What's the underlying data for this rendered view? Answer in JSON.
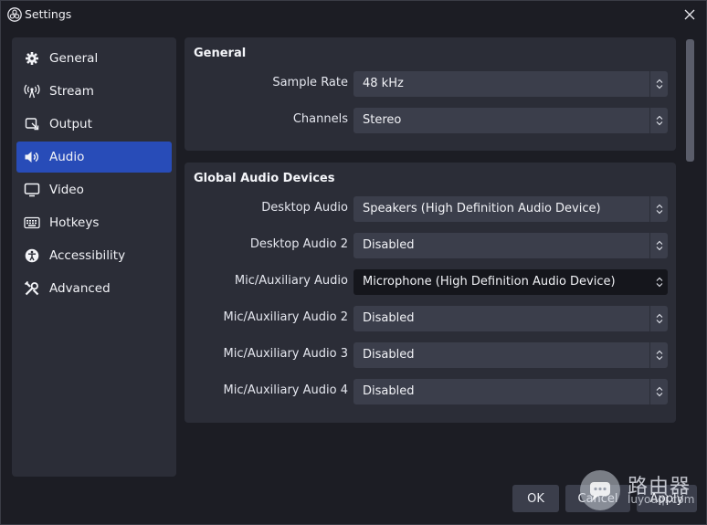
{
  "window": {
    "title": "Settings"
  },
  "sidebar": {
    "items": [
      {
        "label": "General",
        "icon": "gear-icon",
        "active": false
      },
      {
        "label": "Stream",
        "icon": "broadcast-icon",
        "active": false
      },
      {
        "label": "Output",
        "icon": "output-icon",
        "active": false
      },
      {
        "label": "Audio",
        "icon": "speaker-icon",
        "active": true
      },
      {
        "label": "Video",
        "icon": "monitor-icon",
        "active": false
      },
      {
        "label": "Hotkeys",
        "icon": "keyboard-icon",
        "active": false
      },
      {
        "label": "Accessibility",
        "icon": "accessibility-icon",
        "active": false
      },
      {
        "label": "Advanced",
        "icon": "tools-icon",
        "active": false
      }
    ]
  },
  "general": {
    "title": "General",
    "sample_rate": {
      "label": "Sample Rate",
      "value": "48 kHz"
    },
    "channels": {
      "label": "Channels",
      "value": "Stereo"
    }
  },
  "devices": {
    "title": "Global Audio Devices",
    "rows": [
      {
        "label": "Desktop Audio",
        "value": "Speakers (High Definition Audio Device)"
      },
      {
        "label": "Desktop Audio 2",
        "value": "Disabled"
      },
      {
        "label": "Mic/Auxiliary Audio",
        "value": "Microphone (High Definition Audio Device)"
      },
      {
        "label": "Mic/Auxiliary Audio 2",
        "value": "Disabled"
      },
      {
        "label": "Mic/Auxiliary Audio 3",
        "value": "Disabled"
      },
      {
        "label": "Mic/Auxiliary Audio 4",
        "value": "Disabled"
      }
    ]
  },
  "buttons": {
    "ok": "OK",
    "cancel": "Cancel",
    "apply": "Apply"
  },
  "watermark": {
    "text": "路由器",
    "sub": "luyouqi.com"
  },
  "colors": {
    "accent": "#284cb8",
    "panel": "#2b2d37",
    "background": "#1c1d24",
    "combo": "#3b3e4b"
  }
}
